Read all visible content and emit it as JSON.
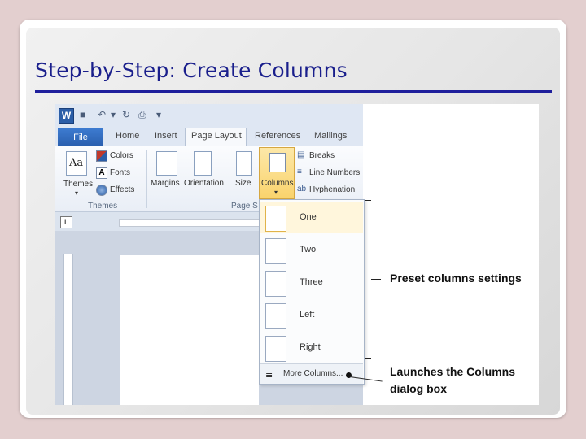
{
  "slide": {
    "title": "Step-by-Step: Create  Columns"
  },
  "word": {
    "logo_letter": "W",
    "tabs": {
      "file": "File",
      "home": "Home",
      "insert": "Insert",
      "page_layout": "Page Layout",
      "references": "References",
      "mailings": "Mailings"
    },
    "ribbon": {
      "themes_btn": "Themes",
      "themes_letters": "Aa",
      "colors": "Colors",
      "fonts": "Fonts",
      "effects": "Effects",
      "themes_group": "Themes",
      "margins": "Margins",
      "orientation": "Orientation",
      "size": "Size",
      "columns": "Columns",
      "breaks": "Breaks",
      "line_numbers": "Line Numbers",
      "hyphenation": "Hyphenation",
      "page_setup_group": "Page S"
    },
    "columns_menu": {
      "items": [
        "One",
        "Two",
        "Three",
        "Left",
        "Right"
      ],
      "more": "More Columns..."
    }
  },
  "callouts": {
    "preset": "Preset columns settings",
    "launches_line1": "Launches the Columns",
    "launches_line2": "dialog box"
  },
  "colors": {
    "title": "#1a1f8c",
    "rule": "#1f1f9c",
    "selected_button": "#f9d36d"
  }
}
